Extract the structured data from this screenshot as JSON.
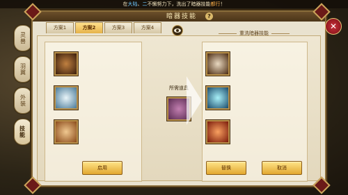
{
  "notice": {
    "prefix": "在",
    "hl1": "大陆",
    "sep": "、",
    "hl2": "二",
    "mid": "不懈努力下，洗出了暗器技能",
    "hl3": "都行",
    "suffix": "！"
  },
  "window": {
    "title": "暗器技能",
    "help": "?",
    "close": "✕"
  },
  "side_tabs": [
    {
      "label": "灵兽"
    },
    {
      "label": "羽翼"
    },
    {
      "label": "外装"
    },
    {
      "label": "技能"
    }
  ],
  "plan_tabs": [
    "方案1",
    "方案2",
    "方案3",
    "方案4"
  ],
  "active_plan": 1,
  "center": {
    "line1": "",
    "line2": "",
    "line3": "",
    "needed_label": "所需道具"
  },
  "right_header": "重洗暗器技能",
  "left_skills": [
    {
      "name": "",
      "desc": "",
      "icon_color": "#6a3a1a"
    },
    {
      "name": "",
      "desc": "",
      "icon_color": "#6a9ab8"
    },
    {
      "name": "",
      "desc": "",
      "icon_color": "#c98a4a"
    }
  ],
  "right_skills": [
    {
      "name": "",
      "desc": "",
      "icon_color": "#5a3018"
    },
    {
      "name": "",
      "desc": "",
      "icon_color": "#2a6a8a"
    },
    {
      "name": "",
      "desc": "",
      "icon_color": "#a83a1a"
    }
  ],
  "buttons": {
    "apply": "启用",
    "replace": "替换",
    "cancel": "取消"
  }
}
